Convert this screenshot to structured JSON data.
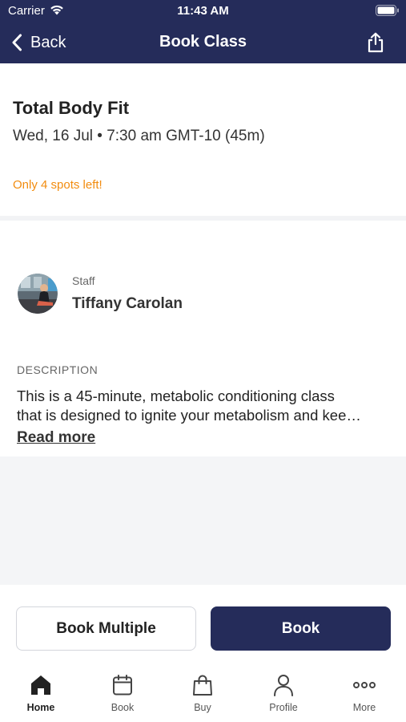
{
  "status_bar": {
    "carrier": "Carrier",
    "time": "11:43 AM"
  },
  "nav": {
    "back_label": "Back",
    "title": "Book Class"
  },
  "class_info": {
    "name": "Total Body Fit",
    "datetime": "Wed, 16 Jul • 7:30 am GMT-10 (45m)",
    "availability": "Only 4 spots left!"
  },
  "staff": {
    "label": "Staff",
    "name": "Tiffany Carolan"
  },
  "description": {
    "heading": "DESCRIPTION",
    "line1": "This is a 45-minute, metabolic conditioning class",
    "line2": "that is designed to ignite your metabolism and kee…",
    "read_more": "Read more"
  },
  "actions": {
    "book_multiple": "Book Multiple",
    "book": "Book"
  },
  "tabs": [
    {
      "label": "Home",
      "icon": "home-icon",
      "active": true
    },
    {
      "label": "Book",
      "icon": "calendar-icon",
      "active": false
    },
    {
      "label": "Buy",
      "icon": "shopping-bag-icon",
      "active": false
    },
    {
      "label": "Profile",
      "icon": "person-icon",
      "active": false
    },
    {
      "label": "More",
      "icon": "more-icon",
      "active": false
    }
  ],
  "colors": {
    "brand": "#252c5a",
    "warning": "#f28c0f",
    "background_muted": "#f4f5f7"
  }
}
